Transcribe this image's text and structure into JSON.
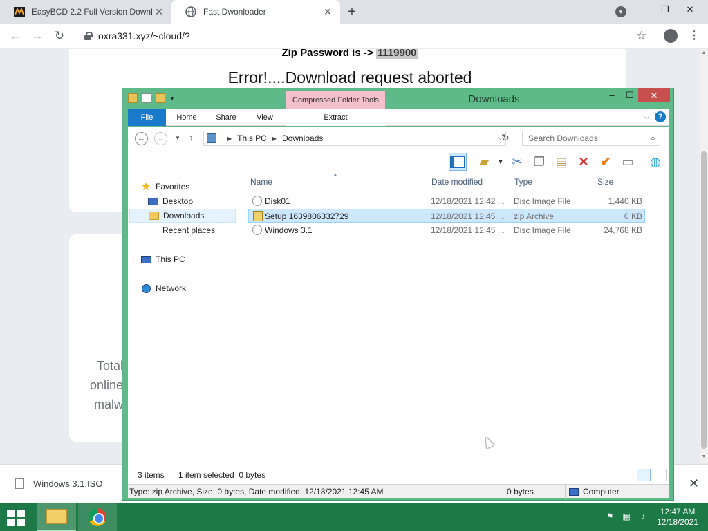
{
  "browser": {
    "tabs": [
      {
        "title": "EasyBCD 2.2 Full Version Downlo",
        "active": false
      },
      {
        "title": "Fast Dwonloader",
        "active": true
      }
    ],
    "url": "oxra331.xyz/~cloud/?"
  },
  "page": {
    "zip_label": "Zip Password is ->",
    "zip_password": "1119900",
    "error": "Error!....Download request aborted",
    "side_lines": [
      "Total",
      "online",
      "malw"
    ]
  },
  "download_bar": {
    "file": "Windows 3.1.ISO"
  },
  "explorer": {
    "title": "Downloads",
    "contextual_tab": "Compressed Folder Tools",
    "ribbon_tabs": [
      "File",
      "Home",
      "Share",
      "View",
      "Extract"
    ],
    "address": {
      "segments": [
        "This PC",
        "Downloads"
      ]
    },
    "search_placeholder": "Search Downloads",
    "nav": {
      "favorites": "Favorites",
      "desktop": "Desktop",
      "downloads": "Downloads",
      "recent": "Recent places",
      "this_pc": "This PC",
      "network": "Network"
    },
    "columns": {
      "name": "Name",
      "date": "Date modified",
      "type": "Type",
      "size": "Size"
    },
    "files": [
      {
        "name": "Disk01",
        "date": "12/18/2021 12:42 ...",
        "type": "Disc Image File",
        "size": "1,440 KB",
        "selected": false
      },
      {
        "name": "Setup 1639806332729",
        "date": "12/18/2021 12:45 ...",
        "type": "zip Archive",
        "size": "0 KB",
        "selected": true
      },
      {
        "name": "Windows 3.1",
        "date": "12/18/2021 12:45 ...",
        "type": "Disc Image File",
        "size": "24,768 KB",
        "selected": false
      }
    ],
    "status": {
      "items": "3 items",
      "selected": "1 item selected  0 bytes"
    },
    "details": {
      "info": "Type: zip Archive, Size: 0 bytes, Date modified: 12/18/2021 12:45 AM",
      "bytes": "0 bytes",
      "location": "Computer"
    }
  },
  "taskbar": {
    "time": "12:47 AM",
    "date": "12/18/2021"
  },
  "colors": {
    "window_frame": "#5fba89",
    "taskbar": "#1d7a47",
    "file_tab": "#1979ca",
    "contextual_tab": "#f3c0cb",
    "selection": "#cce8ff"
  }
}
